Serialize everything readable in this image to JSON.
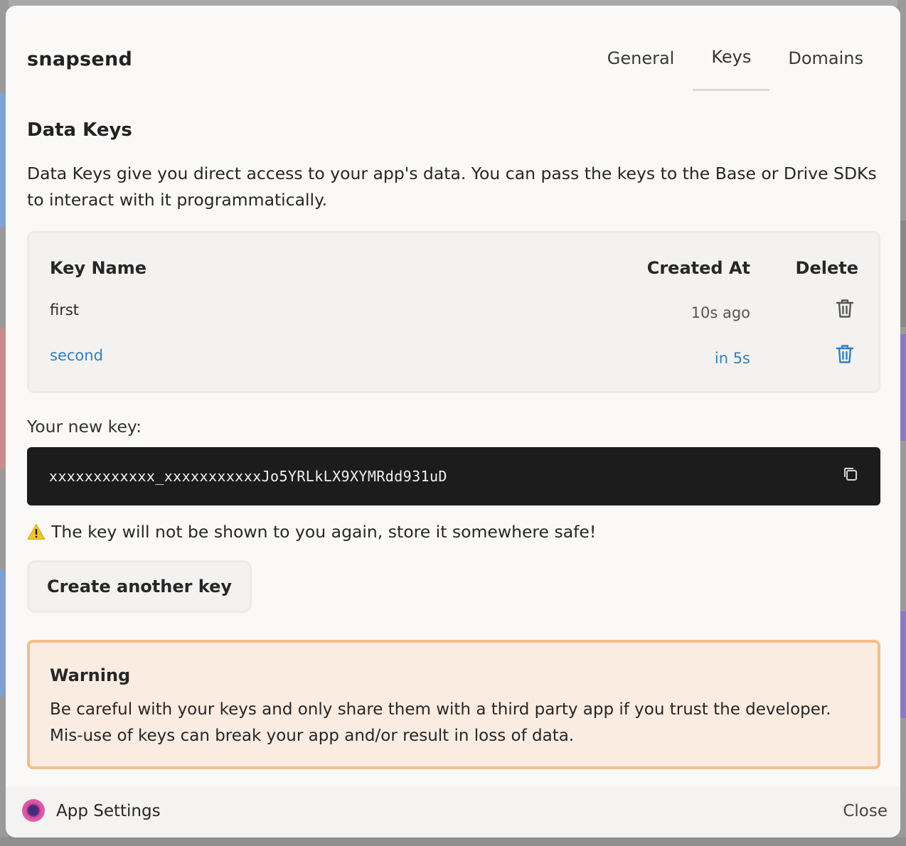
{
  "app": {
    "name": "snapsend"
  },
  "tabs": [
    {
      "label": "General",
      "active": false
    },
    {
      "label": "Keys",
      "active": true
    },
    {
      "label": "Domains",
      "active": false
    }
  ],
  "section": {
    "title": "Data Keys",
    "description": "Data Keys give you direct access to your app's data. You can pass the keys to the Base or Drive SDKs to interact with it programmatically."
  },
  "keys_table": {
    "headers": {
      "name": "Key Name",
      "created": "Created At",
      "delete": "Delete"
    },
    "rows": [
      {
        "name": "first",
        "created": "10s ago",
        "delete_icon": "trash-icon",
        "highlight": false
      },
      {
        "name": "second",
        "created": "in 5s",
        "delete_icon": "trash-icon",
        "highlight": true
      }
    ]
  },
  "new_key": {
    "label": "Your new key:",
    "value": "xxxxxxxxxxxx_xxxxxxxxxxxJo5YRLkLX9XYMRdd931uD",
    "copy_icon": "copy-icon"
  },
  "notice": {
    "icon": "warning-icon",
    "text": "The key will not be shown to you again, store it somewhere safe!"
  },
  "create_button": {
    "label": "Create another key"
  },
  "warning": {
    "title": "Warning",
    "text": "Be careful with your keys and only share them with a third party app if you trust the developer. Mis-use of keys can break your app and/or result in loss of data."
  },
  "footer": {
    "title": "App Settings",
    "close_label": "Close"
  },
  "colors": {
    "accent_link": "#2f7fc0",
    "key_box_bg": "#1c1c1c",
    "warning_bg": "#faece1",
    "warning_border": "#f5bd8b"
  }
}
